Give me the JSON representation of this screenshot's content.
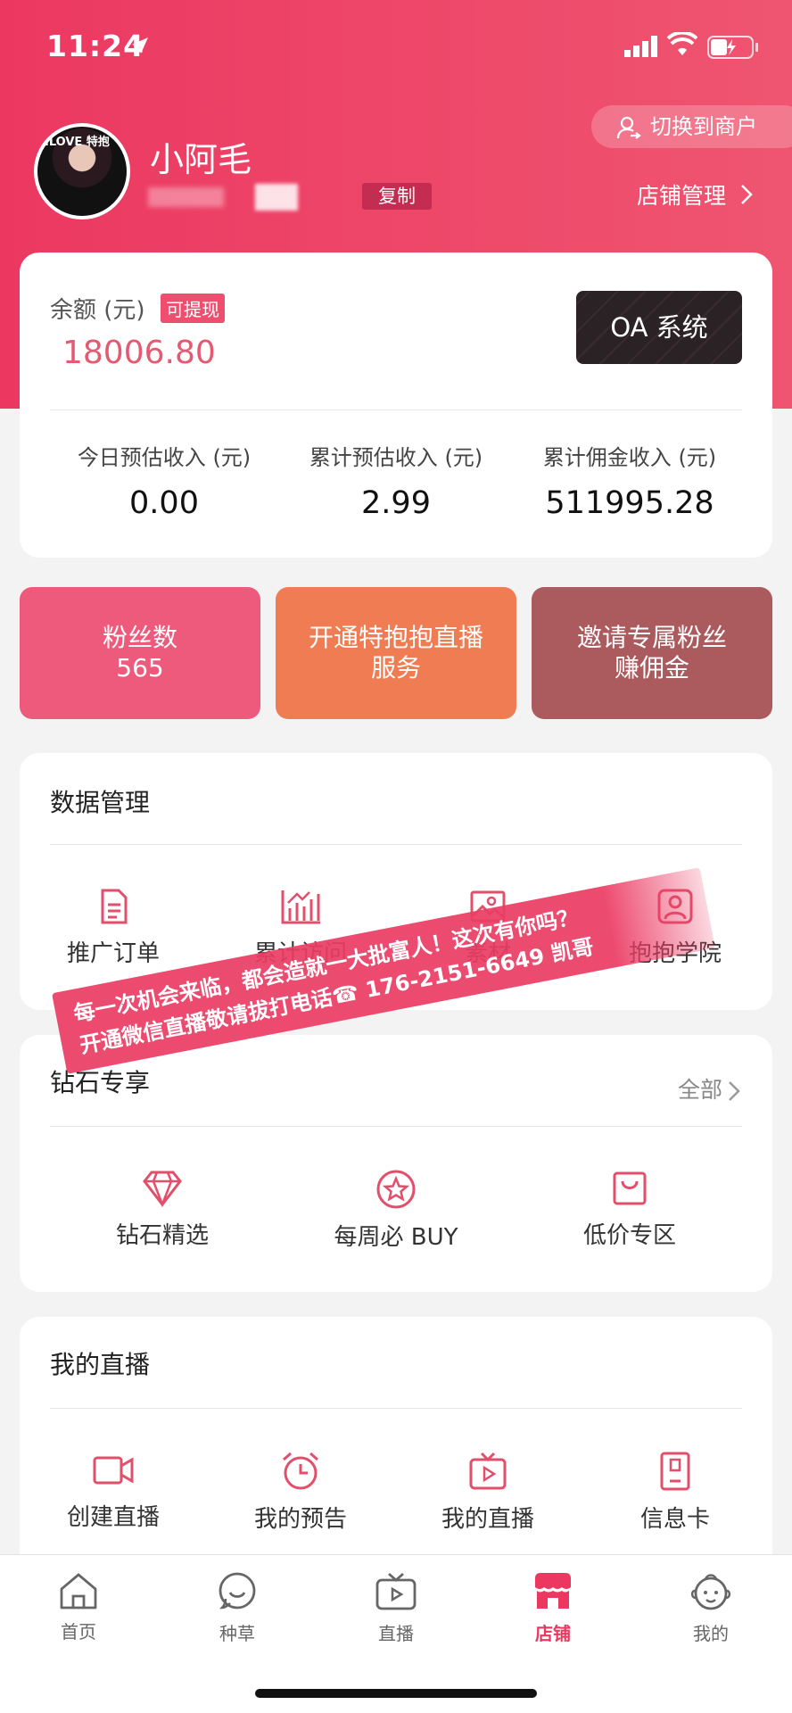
{
  "status_bar": {
    "time": "11:24"
  },
  "profile": {
    "name": "小阿毛",
    "copy_label": "复制",
    "switch_label": "切换到商户",
    "store_manage_label": "店铺管理",
    "avatar_text": "ILOVE 特抱"
  },
  "balance": {
    "label": "余额 (元)",
    "tag": "可提现",
    "value": "18006.80",
    "oa_label": "OA 系统",
    "stats": [
      {
        "label": "今日预估收入 (元)",
        "value": "0.00"
      },
      {
        "label": "累计预估收入 (元)",
        "value": "2.99"
      },
      {
        "label": "累计佣金收入 (元)",
        "value": "511995.28"
      }
    ]
  },
  "tiles": {
    "fans_label": "粉丝数",
    "fans_count": "565",
    "live_line1": "开通特抱抱直播",
    "live_line2": "服务",
    "invite_line1": "邀请专属粉丝",
    "invite_line2": "赚佣金"
  },
  "data_mgmt": {
    "title": "数据管理",
    "items": [
      {
        "label": "推广订单",
        "icon": "document-icon"
      },
      {
        "label": "累计访问",
        "icon": "bar-chart-icon"
      },
      {
        "label": "素材",
        "icon": "image-icon"
      },
      {
        "label": "抱抱学院",
        "icon": "user-card-icon"
      }
    ]
  },
  "diamond": {
    "title": "钻石专享",
    "all_label": "全部",
    "items": [
      {
        "label": "钻石精选",
        "icon": "diamond-icon"
      },
      {
        "label": "每周必 BUY",
        "icon": "star-circle-icon"
      },
      {
        "label": "低价专区",
        "icon": "bag-icon"
      }
    ]
  },
  "my_live": {
    "title": "我的直播",
    "items": [
      {
        "label": "创建直播",
        "icon": "video-camera-icon"
      },
      {
        "label": "我的预告",
        "icon": "alarm-clock-icon"
      },
      {
        "label": "我的直播",
        "icon": "tv-play-icon"
      },
      {
        "label": "信息卡",
        "icon": "id-card-icon"
      }
    ]
  },
  "banner": {
    "line1": "每一次机会来临，都会造就一大批富人！这次有你吗？",
    "line2": "开通微信直播敬请拔打电话☎ 176-2151-6649  凯哥"
  },
  "tabbar": {
    "items": [
      {
        "label": "首页",
        "icon": "home-icon"
      },
      {
        "label": "种草",
        "icon": "chat-bubble-icon"
      },
      {
        "label": "直播",
        "icon": "tv-icon"
      },
      {
        "label": "店铺",
        "icon": "shop-icon"
      },
      {
        "label": "我的",
        "icon": "baby-face-icon"
      }
    ],
    "active_index": 3
  },
  "colors": {
    "brand": "#ec3861",
    "accent_text": "#e35a72"
  }
}
